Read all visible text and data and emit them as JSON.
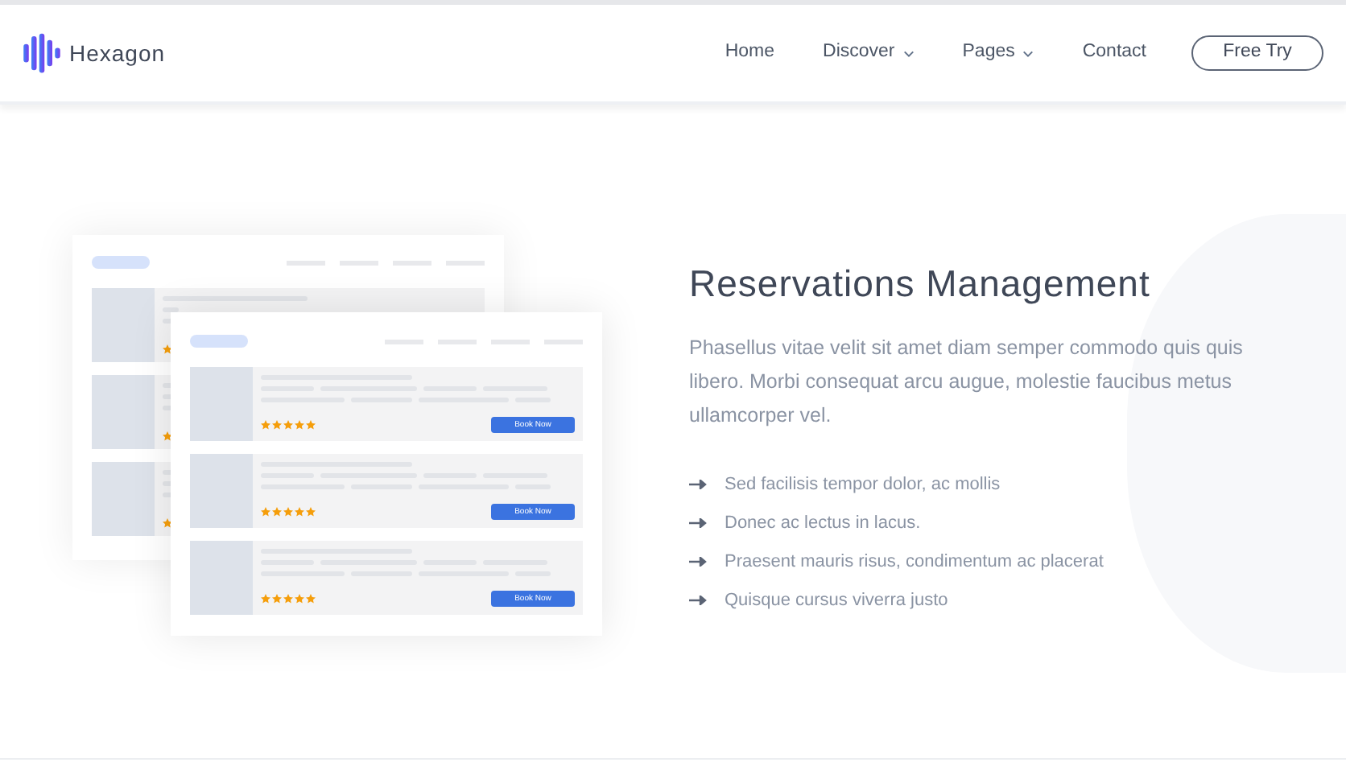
{
  "brand": {
    "name": "Hexagon"
  },
  "nav": [
    {
      "label": "Home",
      "dropdown": false
    },
    {
      "label": "Discover",
      "dropdown": true
    },
    {
      "label": "Pages",
      "dropdown": true
    },
    {
      "label": "Contact",
      "dropdown": false
    }
  ],
  "cta": "Free Try",
  "illustration": {
    "listings": [
      {
        "stars": 5,
        "button": "Book Now"
      },
      {
        "stars": 5,
        "button": "Book Now"
      },
      {
        "stars": 5,
        "button": "Book Now"
      }
    ]
  },
  "feature": {
    "title": "Reservations Management",
    "body": "Phasellus vitae velit sit amet diam semper commodo quis quis libero. Morbi consequat arcu augue, molestie faucibus metus ullamcorper vel.",
    "points": [
      "Sed facilisis tempor dolor, ac mollis",
      "Donec ac lectus in lacus.",
      "Praesent mauris risus, condimentum ac placerat",
      "Quisque cursus viverra justo"
    ]
  }
}
